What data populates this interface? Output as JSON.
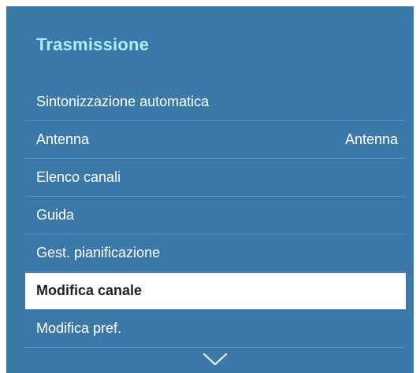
{
  "menu": {
    "title": "Trasmissione",
    "items": [
      {
        "label": "Sintonizzazione automatica",
        "value": ""
      },
      {
        "label": "Antenna",
        "value": "Antenna"
      },
      {
        "label": "Elenco canali",
        "value": ""
      },
      {
        "label": "Guida",
        "value": ""
      },
      {
        "label": "Gest. pianificazione",
        "value": ""
      },
      {
        "label": "Modifica canale",
        "value": "",
        "selected": true
      },
      {
        "label": "Modifica pref.",
        "value": ""
      }
    ],
    "scroll_icon": "chevron-down-icon"
  },
  "colors": {
    "panel_bg": "#3b79a9",
    "title": "#a6f3ff",
    "selected_bg": "#ffffff",
    "selected_text": "#222222"
  }
}
